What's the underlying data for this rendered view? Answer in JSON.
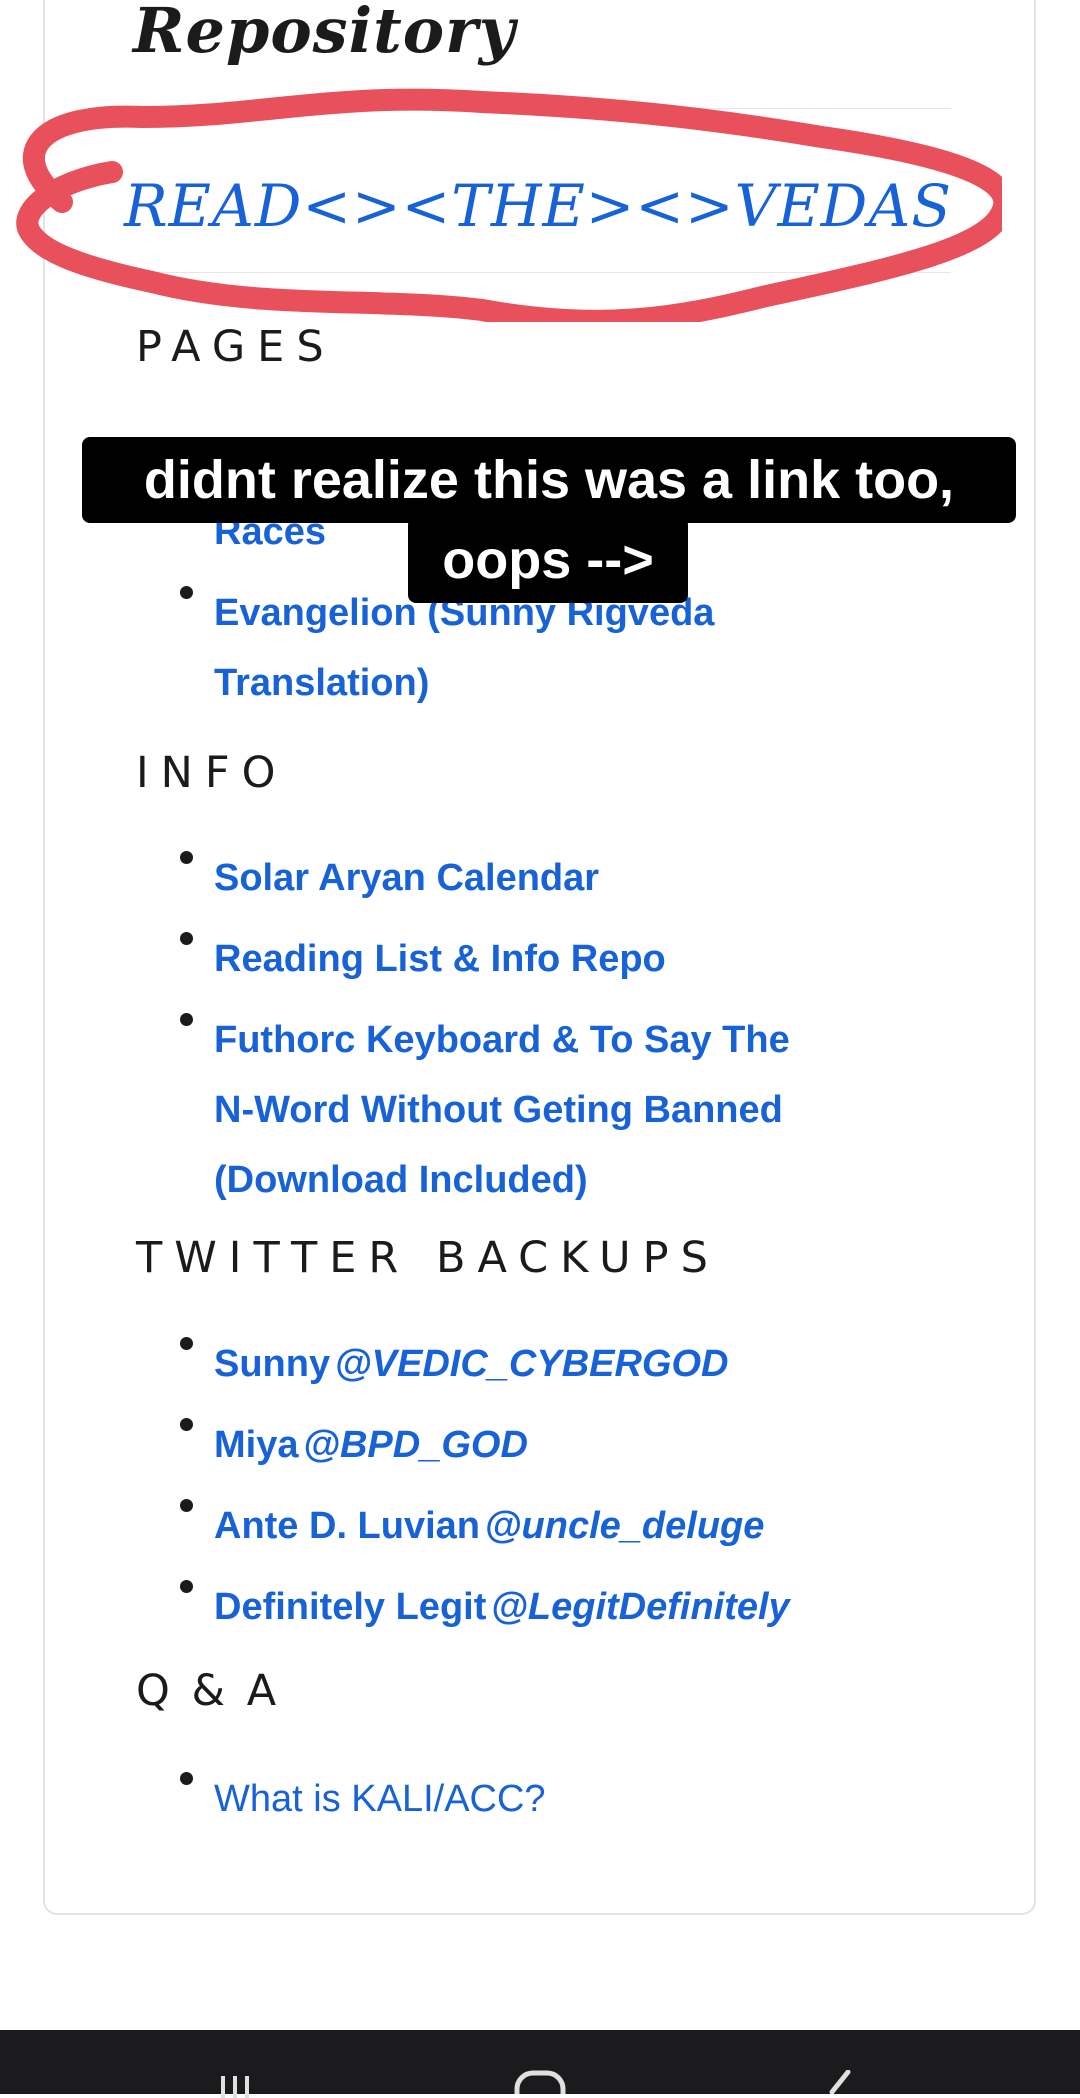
{
  "site": {
    "title": "Repository",
    "main_link": "READ<><THE><>VEDAS"
  },
  "sections": {
    "pages": {
      "heading": "PAGES",
      "items": [
        {
          "label": "Races"
        },
        {
          "label_line1": "Evangelion (Sunny Rigveda",
          "label_line2": "Translation)"
        }
      ]
    },
    "info": {
      "heading": "INFO",
      "items": [
        {
          "lines": [
            "Solar Aryan Calendar"
          ]
        },
        {
          "lines": [
            "Reading List & Info Repo"
          ]
        },
        {
          "lines": [
            "Futhorc Keyboard & To Say The",
            "N-Word Without Geting Banned",
            "(Download Included)"
          ]
        }
      ]
    },
    "twitter": {
      "heading": "TWITTER BACKUPS",
      "items": [
        {
          "name": "Sunny",
          "handle": "@VEDIC_CYBERGOD"
        },
        {
          "name": "Miya",
          "handle": "@BPD_GOD"
        },
        {
          "name": "Ante D. Luvian",
          "handle": "@uncle_deluge"
        },
        {
          "name": "Definitely Legit",
          "handle": "@LegitDefinitely"
        }
      ]
    },
    "qa": {
      "heading": "Q & A",
      "items": [
        {
          "label": "What is KALI/ACC?"
        }
      ]
    }
  },
  "overlay": {
    "caption_line1": "didnt realize this was a link too,",
    "caption_line2": "oops -->",
    "circle_color": "#e8505b"
  },
  "colors": {
    "link": "#1762d6",
    "text": "#1b1b1b",
    "navbar": "#1b1b1d"
  },
  "navbar": {
    "icons": [
      "recent-apps-icon",
      "home-icon",
      "back-icon"
    ]
  }
}
